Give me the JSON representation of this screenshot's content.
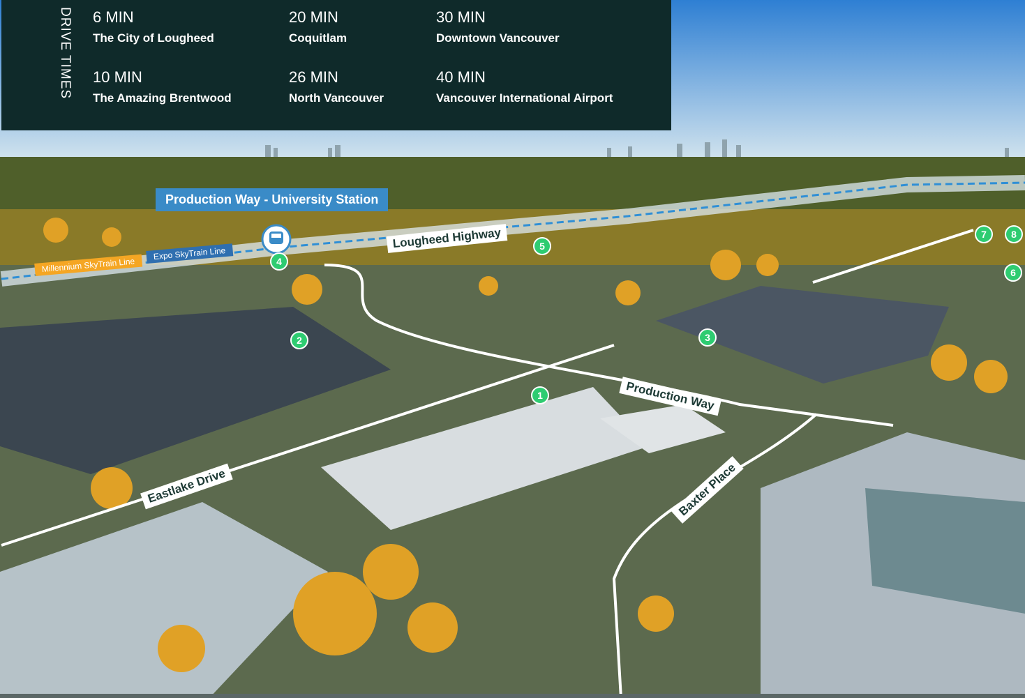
{
  "drive_times": {
    "heading": "DRIVE TIMES",
    "items": [
      {
        "time": "6 MIN",
        "place": "The City of Lougheed"
      },
      {
        "time": "20 MIN",
        "place": "Coquitlam"
      },
      {
        "time": "30 MIN",
        "place": "Downtown Vancouver"
      },
      {
        "time": "10 MIN",
        "place": "The Amazing Brentwood"
      },
      {
        "time": "26 MIN",
        "place": "North Vancouver"
      },
      {
        "time": "40 MIN",
        "place": "Vancouver International Airport"
      }
    ]
  },
  "map": {
    "station_label": "Production Way - University Station",
    "skytrain_lines": {
      "millennium": "Millennium SkyTrain Line",
      "expo": "Expo SkyTrain Line"
    },
    "roads": {
      "lougheed": "Lougheed Highway",
      "production": "Production Way",
      "eastlake": "Eastlake Drive",
      "baxter": "Baxter Place"
    },
    "markers": [
      "1",
      "2",
      "3",
      "4",
      "5",
      "6",
      "7",
      "8"
    ],
    "colors": {
      "panel": "#0f2a2a",
      "marker": "#2ecc71",
      "station": "#3a8bc7",
      "millennium": "#f5a623"
    }
  }
}
